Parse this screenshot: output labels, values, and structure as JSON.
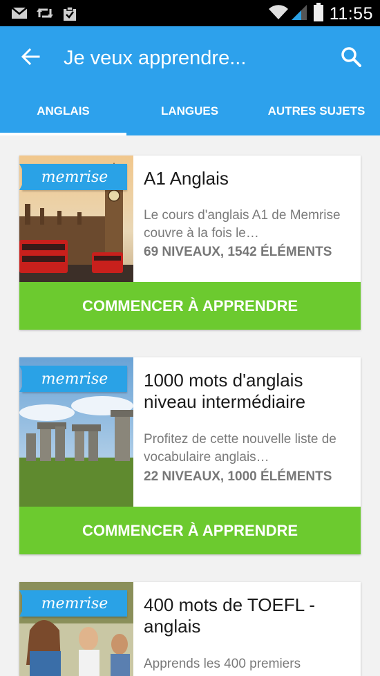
{
  "status_bar": {
    "time": "11:55",
    "icons": [
      "gmail-icon",
      "retweet-icon",
      "clipboard-icon",
      "wifi-icon",
      "signal-icon",
      "battery-icon"
    ]
  },
  "app_bar": {
    "title": "Je veux apprendre...",
    "color": "#2da1ec"
  },
  "tabs": [
    {
      "label": "ANGLAIS",
      "selected": true
    },
    {
      "label": "LANGUES",
      "selected": false
    },
    {
      "label": "AUTRES SUJETS",
      "selected": false
    }
  ],
  "courses": [
    {
      "brand": "memrise",
      "title": "A1 Anglais",
      "description": "Le cours d'anglais A1 de Memrise couvre à la fois le…",
      "meta": "69 NIVEAUX, 1542 ÉLÉMENTS",
      "button": "COMMENCER À APPRENDRE"
    },
    {
      "brand": "memrise",
      "title": "1000 mots d'anglais niveau intermédiaire",
      "description": "Profitez de cette nouvelle liste de vocabulaire anglais…",
      "meta": "22 NIVEAUX, 1000 ÉLÉMENTS",
      "button": "COMMENCER À APPRENDRE"
    },
    {
      "brand": "memrise",
      "title": "400 mots de TOEFL - anglais",
      "description": "Apprends les 400 premiers"
    }
  ],
  "colors": {
    "accent": "#2da1ec",
    "button": "#6cca2f"
  }
}
